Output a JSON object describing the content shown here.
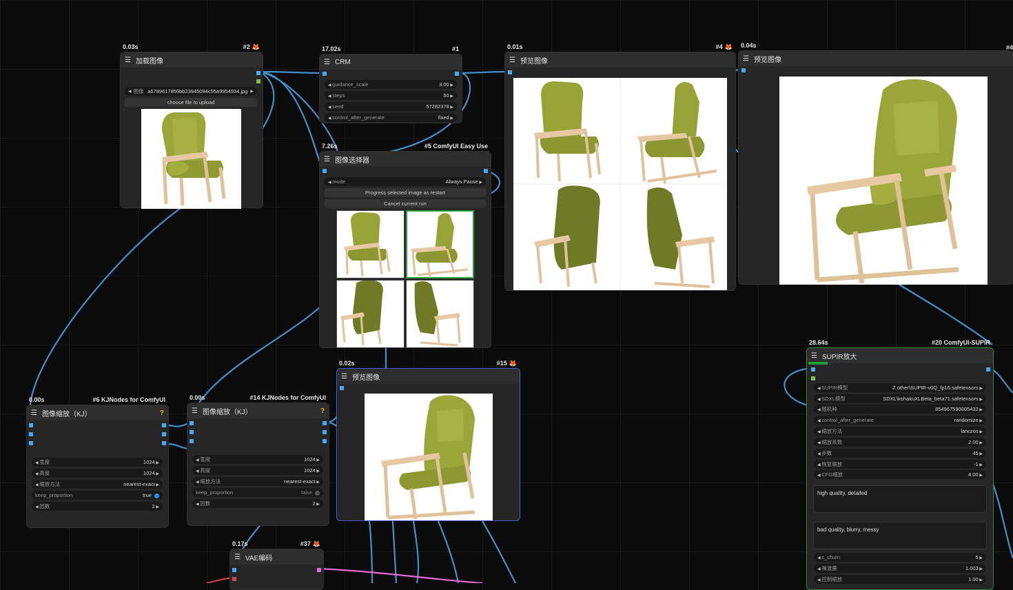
{
  "colors": {
    "canvas": "#0b0b0b",
    "node_bg": "#262626",
    "wire_image": "#4a9fe0",
    "wire_latent": "#e46cd6",
    "selected_border_blue": "#4a5bd1",
    "selected_border_green": "#2e8b3a"
  },
  "nodes": {
    "load_image": {
      "time": "0.03s",
      "id": "#2",
      "title": "加载图像",
      "widget_label": "图像",
      "widget_value": "a6789617855bb23945094c55a9954934.jpg",
      "button": "choose file to upload"
    },
    "crm": {
      "time": "17.02s",
      "id": "#1",
      "title": "CRM",
      "widgets": [
        {
          "label": "guidance_scale",
          "value": "3.00"
        },
        {
          "label": "steps",
          "value": "50"
        },
        {
          "label": "seed",
          "value": "57282378"
        },
        {
          "label": "control_after_generate",
          "value": "fixed"
        }
      ]
    },
    "preview_4": {
      "time": "0.01s",
      "id": "#4",
      "title": "预览图像"
    },
    "preview_right": {
      "time": "0.04s",
      "id": "#4",
      "title": "预览图像"
    },
    "image_selector": {
      "time": "7.26s",
      "id": "#5 ComfyUI Easy Use",
      "title": "图像选择器",
      "mode_label": "mode",
      "mode_value": "Always Pause",
      "button_progress": "Progress selected image as restart",
      "button_cancel": "Cancel current run"
    },
    "preview_15": {
      "time": "0.02s",
      "id": "#15",
      "title": "预览图像"
    },
    "resize_6": {
      "time": "0.00s",
      "id": "#6 KJNodes for ComfyUI",
      "title": "图像缩放（KJ）",
      "widgets": [
        {
          "label": "宽度",
          "value": "1024"
        },
        {
          "label": "高度",
          "value": "1024"
        },
        {
          "label": "缩放方法",
          "value": "nearest-exact"
        },
        {
          "label": "keep_proportion",
          "value": "true"
        },
        {
          "label": "因数",
          "value": "2"
        }
      ]
    },
    "resize_14": {
      "time": "0.00s",
      "id": "#14 KJNodes for ComfyUI",
      "title": "图像缩放（KJ）",
      "widgets": [
        {
          "label": "宽度",
          "value": "1024"
        },
        {
          "label": "高度",
          "value": "1024"
        },
        {
          "label": "缩放方法",
          "value": "nearest-exact"
        },
        {
          "label": "keep_proportion",
          "value": "false"
        },
        {
          "label": "因数",
          "value": "2"
        }
      ]
    },
    "vae_encode": {
      "time": "0.17s",
      "id": "#37",
      "title": "VAE编码"
    },
    "supir": {
      "time": "28.64s",
      "id": "#20 ComfyUI-SUPIR",
      "title": "SUPIR放大",
      "widgets": [
        {
          "label": "SUPIR模型",
          "value": "Z other\\SUPIR-v0Q_fp16.safetensors"
        },
        {
          "label": "SDXL模型",
          "value": "SDXL\\kohakuXLBeta_beta71.safetensors"
        },
        {
          "label": "随机种",
          "value": "854967590005432"
        },
        {
          "label": "control_after_generate",
          "value": "randomize"
        },
        {
          "label": "缩放方法",
          "value": "lanczos"
        },
        {
          "label": "缩放系数",
          "value": "2.00"
        },
        {
          "label": "步数",
          "value": "45"
        },
        {
          "label": "恢复缩放",
          "value": "-1"
        },
        {
          "label": "CFG缩放",
          "value": "4.00"
        }
      ],
      "positive_prompt": "high quality, detailed",
      "negative_prompt": "bad quality, blurry, messy",
      "widgets_bottom": [
        {
          "label": "s_churn",
          "value": "5"
        },
        {
          "label": "噪波量",
          "value": "1.003"
        },
        {
          "label": "控制缩放",
          "value": "1.00"
        }
      ]
    },
    "edge_right": {
      "id": "#4"
    }
  }
}
